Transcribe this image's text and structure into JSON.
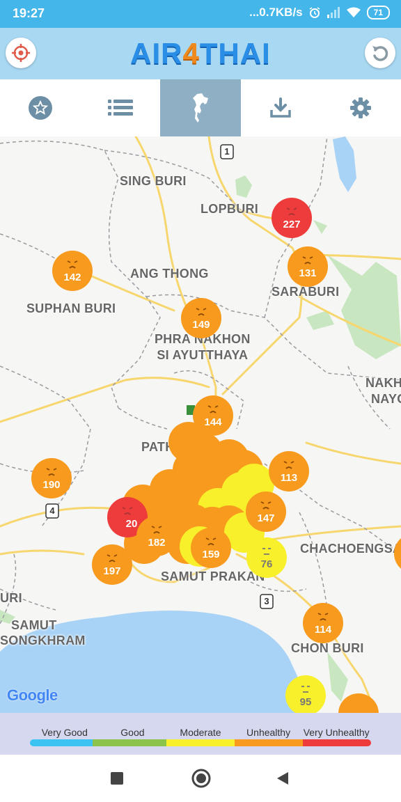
{
  "status": {
    "time": "19:27",
    "speed": "...0.7KB/s",
    "battery": "71"
  },
  "header": {
    "logo_parts": [
      "AIR",
      "4",
      "THAI"
    ]
  },
  "tabs": [
    "favorites",
    "list",
    "map",
    "download",
    "settings"
  ],
  "active_tab": "map",
  "places": {
    "sing_buri": "SING BURI",
    "lopburi": "LOPBURI",
    "ang_thong": "ANG THONG",
    "saraburi": "SARABURI",
    "suphan_buri": "SUPHAN BURI",
    "phra_nakhon_1": "PHRA NAKHON",
    "phra_nakhon_2": "SI AYUTTHAYA",
    "nakh": "NAKH",
    "nayo": "NAYO",
    "path": "PATH",
    "chachoengsao": "CHACHOENGSA",
    "samut_prakan": "SAMUT PRAKAN",
    "uri": "URI",
    "samut": "SAMUT",
    "songkhram": "SONGKHRAM",
    "chon_buri": "CHON BURI"
  },
  "route_shields": [
    "1",
    "4",
    "3"
  ],
  "markers": {
    "m227": "227",
    "m142": "142",
    "m131": "131",
    "m149": "149",
    "m144": "144",
    "m113": "113",
    "m190": "190",
    "m147": "147",
    "m20": "20",
    "m182": "182",
    "m159": "159",
    "m76": "76",
    "m197": "197",
    "m114": "114",
    "m95": "95"
  },
  "map_attribution": "Google",
  "legend": [
    "Very Good",
    "Good",
    "Moderate",
    "Unhealthy",
    "Very Unhealthy"
  ],
  "colors": {
    "very_good": "#3cc3f2",
    "good": "#8cc34a",
    "moderate": "#f8f02a",
    "unhealthy": "#f79a1e",
    "very_unhealthy": "#ee3b3b",
    "accent": "#44b6ea"
  }
}
